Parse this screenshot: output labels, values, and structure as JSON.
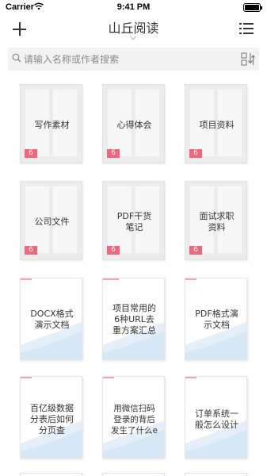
{
  "status_bar": {
    "carrier": "Carrier",
    "time": "9:41 PM"
  },
  "nav": {
    "title": "山丘阅读"
  },
  "search": {
    "placeholder": "请输入名称或作者搜索"
  },
  "folders": [
    {
      "title": "写作素材",
      "count": "6"
    },
    {
      "title": "心得体会",
      "count": "6"
    },
    {
      "title": "项目资料",
      "count": "6"
    },
    {
      "title": "公司文件",
      "count": "6"
    },
    {
      "title": "PDF干货\n笔记",
      "count": "6"
    },
    {
      "title": "面试求职\n资料",
      "count": "6"
    }
  ],
  "documents": [
    {
      "title": "DOCX格式\n演示文档"
    },
    {
      "title": "项目常用的\n6种URL去\n重方案汇总"
    },
    {
      "title": "PDF格式演\n示文档"
    },
    {
      "title": "百亿级数据\n分表后如何\n分页查"
    },
    {
      "title": "用微信扫码\n登录的背后\n发生了什么e"
    },
    {
      "title": "订单系统一\n般怎么设计"
    }
  ],
  "colors": {
    "badge": "#f0667a",
    "folder_bg": "#ececec",
    "doc_wave": "#dceaf7"
  }
}
